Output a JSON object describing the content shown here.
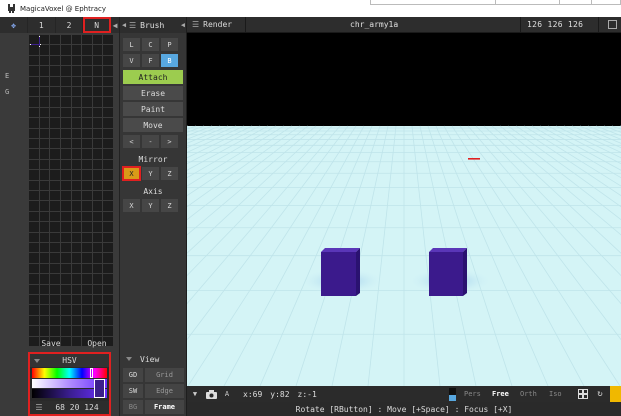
{
  "window": {
    "title": "MagicaVoxel @ Ephtracy"
  },
  "palette": {
    "tabs": [
      "1",
      "2",
      "N"
    ],
    "side_labels": [
      "E",
      "G"
    ],
    "save_label": "Save",
    "open_label": "Open",
    "hsv_label": "HSV",
    "color_values": "68 20 124",
    "selected_color": "#3b1f8a"
  },
  "brush": {
    "title": "Brush",
    "shape_row1": [
      "L",
      "C",
      "P"
    ],
    "shape_row2": [
      "V",
      "F",
      "B"
    ],
    "modes": [
      "Attach",
      "Erase",
      "Paint",
      "Move"
    ],
    "nudge": [
      "<",
      "-",
      ">"
    ],
    "mirror_label": "Mirror",
    "mirror_axes": [
      "X",
      "Y",
      "Z"
    ],
    "axis_label": "Axis",
    "axis_axes": [
      "X",
      "Y",
      "Z"
    ],
    "active_mode_color": "#9ccc4f",
    "active_shape_color": "#58a8e0",
    "mirror_on_color": "#d99a18"
  },
  "view": {
    "title": "View",
    "rows": [
      {
        "key": "GD",
        "value": "Grid"
      },
      {
        "key": "SW",
        "value": "Edge"
      },
      {
        "key": "BG",
        "value": "Frame"
      }
    ]
  },
  "render": {
    "title": "Render",
    "model_name": "chr_army1a",
    "size": "126 126 126"
  },
  "viewport": {
    "background_top": "#000000",
    "ground_color": "#d4f4f6",
    "voxel_color": "#3b1a8c"
  },
  "bottom": {
    "label_a": "A",
    "x": "x:69",
    "y": "y:82",
    "z": "z:-1",
    "projections": [
      "Pers",
      "Free",
      "Orth",
      "Iso"
    ],
    "active_projection": "Free"
  },
  "status": {
    "text": "Rotate [RButton] : Move [+Space] : Focus [+X]"
  }
}
